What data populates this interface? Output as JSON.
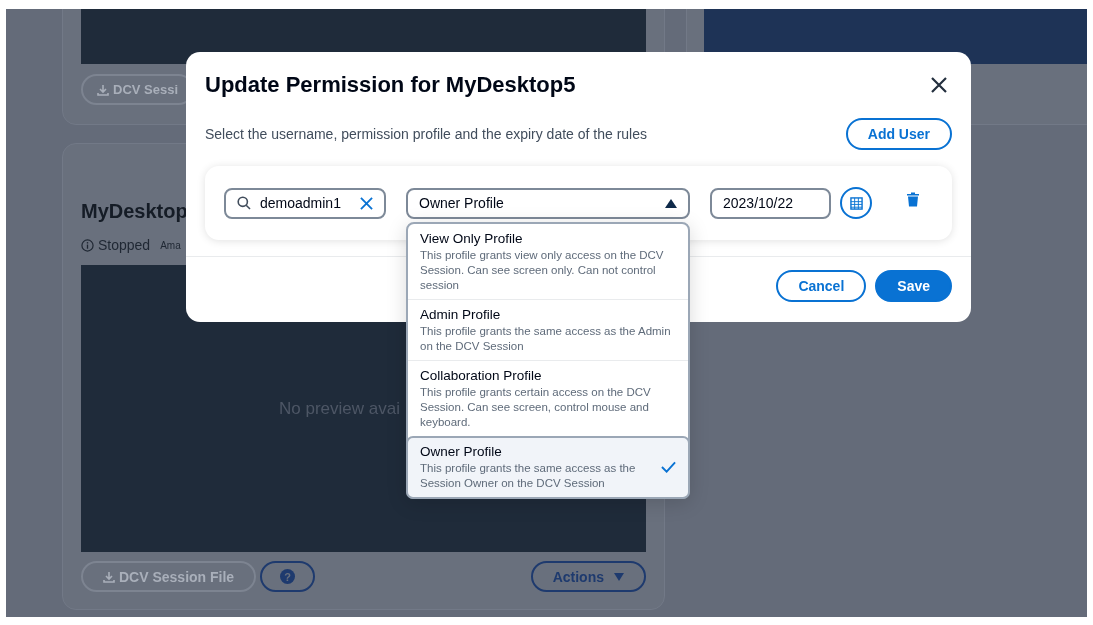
{
  "background": {
    "top_card": {
      "button": "DCV Sessi"
    },
    "desktop_card": {
      "title": "MyDesktop",
      "status": "Stopped",
      "subtitle": "Ama",
      "preview_text": "No preview avai",
      "file_button": "DCV Session File",
      "help_button": "?",
      "actions_button": "Actions"
    }
  },
  "dialog": {
    "title": "Update Permission for MyDesktop5",
    "description": "Select the username, permission profile and the expiry date of the rules",
    "add_button": "Add User",
    "rule": {
      "username": "demoadmin1",
      "profile": "Owner Profile",
      "expanded": true,
      "date": "2023/10/22"
    },
    "profile_options": [
      {
        "name": "View Only Profile",
        "description": "This profile grants view only access on the DCV Session. Can see screen only. Can not control session",
        "selected": false
      },
      {
        "name": "Admin Profile",
        "description": "This profile grants the same access as the Admin on the DCV Session",
        "selected": false
      },
      {
        "name": "Collaboration Profile",
        "description": "This profile grants certain access on the DCV Session. Can see screen, control mouse and keyboard.",
        "selected": false
      },
      {
        "name": "Owner Profile",
        "description": "This profile grants the same access as the Session Owner on the DCV Session",
        "selected": true
      }
    ],
    "buttons": [
      "Cancel",
      "Save"
    ]
  }
}
